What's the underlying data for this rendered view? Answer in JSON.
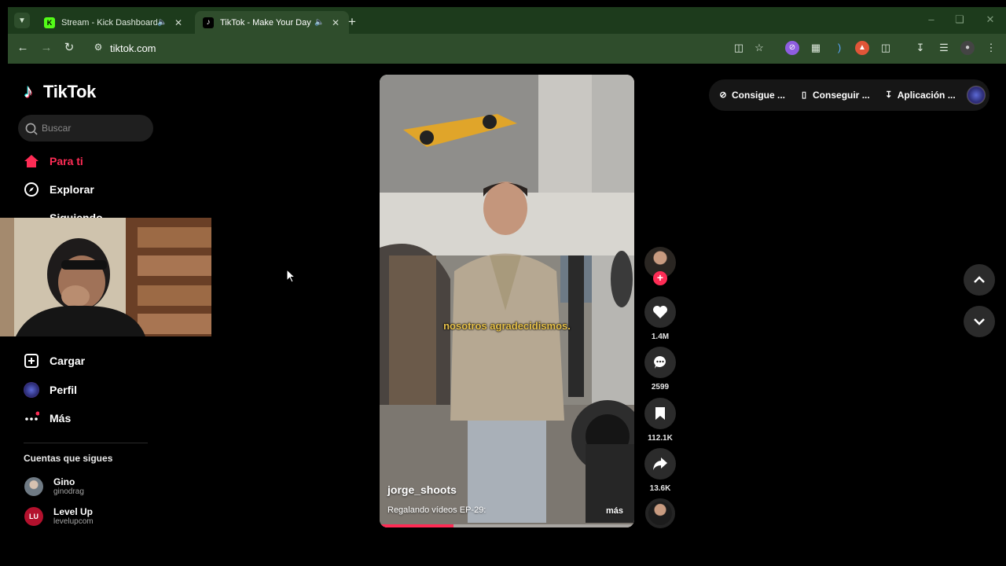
{
  "browser": {
    "tabs": [
      {
        "title": "Stream - Kick Dashboard",
        "favicon": "kick-icon",
        "audio": true
      },
      {
        "title": "TikTok - Make Your Day",
        "favicon": "tiktok-icon",
        "audio": true,
        "active": true
      }
    ],
    "url": "tiktok.com"
  },
  "tiktok": {
    "logo_text": "TikTok",
    "search_placeholder": "Buscar",
    "nav": [
      {
        "label": "Para ti",
        "icon": "home-icon",
        "active": true
      },
      {
        "label": "Explorar",
        "icon": "compass-icon"
      },
      {
        "label": "Siguiendo",
        "icon": "following-icon"
      },
      {
        "label": "Cargar",
        "icon": "upload-icon"
      },
      {
        "label": "Perfil",
        "icon": "profile-avatar-icon"
      },
      {
        "label": "Más",
        "icon": "more-icon"
      }
    ],
    "following_title": "Cuentas que sigues",
    "accounts": [
      {
        "name": "Gino",
        "handle": "ginodrag"
      },
      {
        "name": "Level Up",
        "handle": "levelupcom"
      }
    ],
    "top_actions": [
      "Consigue ...",
      "Conseguir ...",
      "Aplicación ..."
    ]
  },
  "video": {
    "overlay_caption": "nosotros agradecidismos.",
    "author": "jorge_shoots",
    "description": "Regalando vídeos EP-29:",
    "more_label": "más",
    "progress": 0.29,
    "likes": "1.4M",
    "comments": "2599",
    "saves": "112.1K",
    "shares": "13.6K"
  },
  "colors": {
    "brand": "#fe2c55",
    "chrome_tabbar": "#1d3b1c",
    "chrome_toolbar": "#2f4d2c"
  }
}
